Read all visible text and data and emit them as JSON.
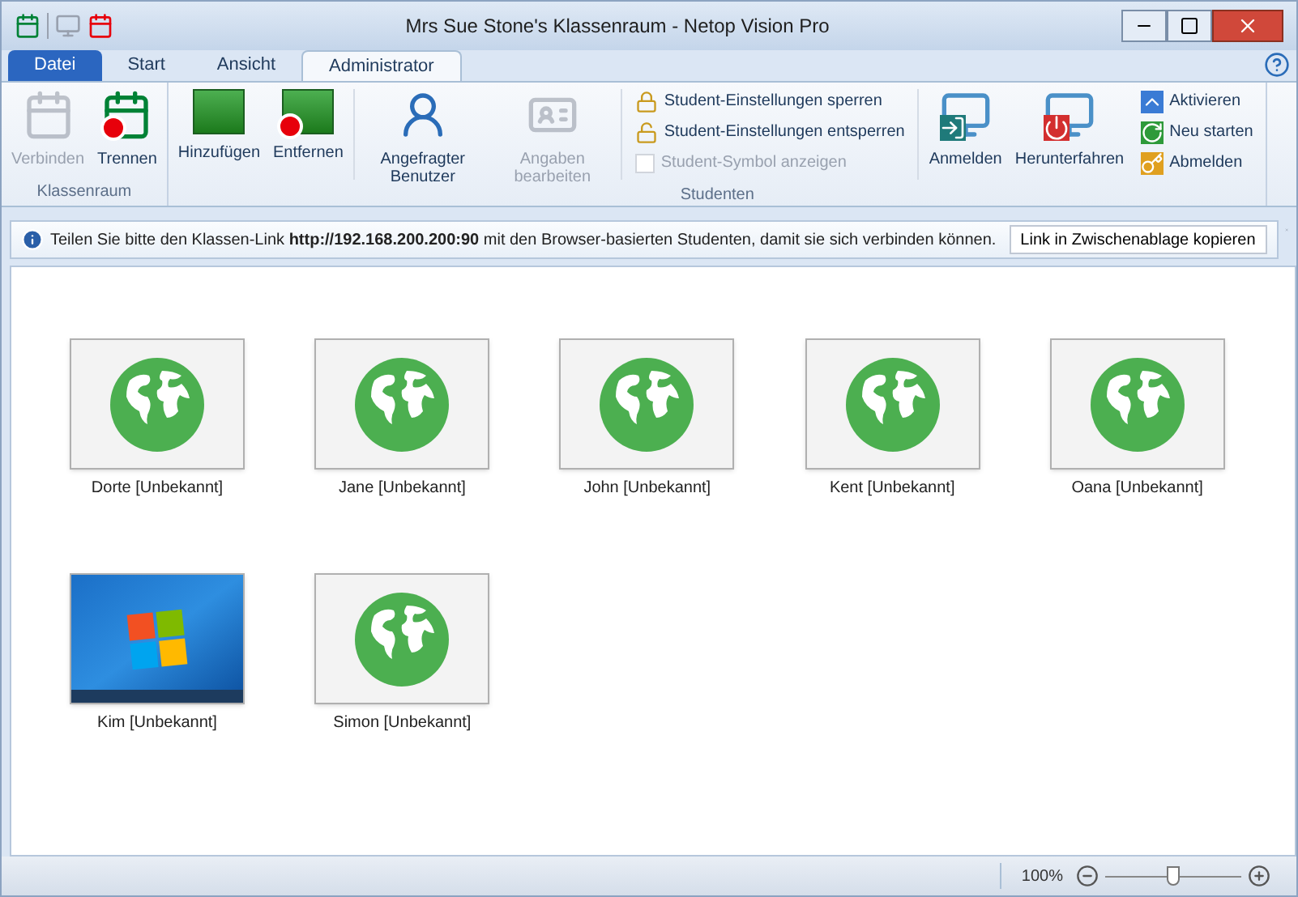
{
  "window": {
    "title": "Mrs Sue Stone's Klassenraum - Netop Vision Pro"
  },
  "tabs": [
    {
      "label": "Datei",
      "kind": "file",
      "selected": false
    },
    {
      "label": "Start",
      "kind": "tab",
      "selected": false
    },
    {
      "label": "Ansicht",
      "kind": "tab",
      "selected": false
    },
    {
      "label": "Administrator",
      "kind": "tab",
      "selected": true
    }
  ],
  "ribbon": {
    "groups": [
      {
        "label": "Klassenraum",
        "items": [
          {
            "kind": "large",
            "label": "Verbinden",
            "disabled": true
          },
          {
            "kind": "large",
            "label": "Trennen",
            "disabled": false
          }
        ]
      },
      {
        "label": "Studenten",
        "items": [
          {
            "kind": "large",
            "label": "Hinzufügen",
            "disabled": false
          },
          {
            "kind": "large",
            "label": "Entfernen",
            "disabled": false
          },
          {
            "kind": "divider"
          },
          {
            "kind": "large",
            "label": "Angefragter Benutzer",
            "disabled": false
          },
          {
            "kind": "large",
            "label": "Angaben bearbeiten",
            "disabled": true
          },
          {
            "kind": "divider"
          },
          {
            "kind": "stack",
            "rows": [
              {
                "kind": "small",
                "label": "Student-Einstellungen sperren",
                "disabled": false
              },
              {
                "kind": "small",
                "label": "Student-Einstellungen entsperren",
                "disabled": false
              },
              {
                "kind": "check",
                "label": "Student-Symbol anzeigen",
                "checked": false,
                "disabled": true
              }
            ]
          },
          {
            "kind": "divider"
          },
          {
            "kind": "large",
            "label": "Anmelden",
            "disabled": false
          },
          {
            "kind": "large",
            "label": "Herunterfahren",
            "disabled": false
          },
          {
            "kind": "stack",
            "rows": [
              {
                "kind": "small",
                "label": "Aktivieren",
                "disabled": false
              },
              {
                "kind": "small",
                "label": "Neu starten",
                "disabled": false
              },
              {
                "kind": "small",
                "label": "Abmelden",
                "disabled": false
              }
            ]
          }
        ]
      }
    ]
  },
  "info_bar": {
    "message": "Teilen Sie bitte den Klassen-Link **http://192.168.200.200:90** mit den Browser-basierten Studenten, damit sie sich verbinden können.",
    "button": "Link in Zwischenablage kopieren"
  },
  "students": [
    {
      "name": "Dorte [Unbekannt]",
      "kind": "web"
    },
    {
      "name": "Jane [Unbekannt]",
      "kind": "web"
    },
    {
      "name": "John [Unbekannt]",
      "kind": "web"
    },
    {
      "name": "Kent [Unbekannt]",
      "kind": "web"
    },
    {
      "name": "Oana [Unbekannt]",
      "kind": "web"
    },
    {
      "name": "Kim [Unbekannt]",
      "kind": "desktop"
    },
    {
      "name": "Simon [Unbekannt]",
      "kind": "web"
    }
  ],
  "status_bar": {
    "zoom": "100%",
    "level": 0.5
  }
}
